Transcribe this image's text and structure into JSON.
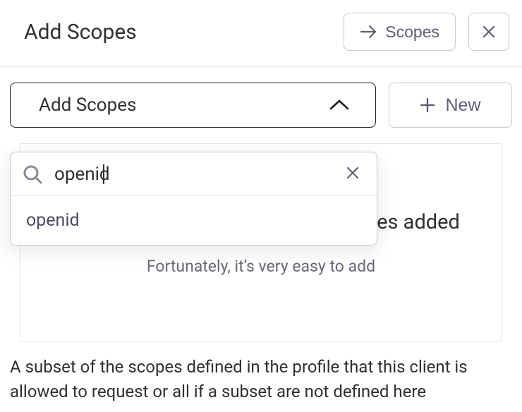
{
  "header": {
    "title": "Add Scopes",
    "scopes_button": "Scopes"
  },
  "toolbar": {
    "dropdown_label": "Add Scopes",
    "new_button": "New"
  },
  "dropdown": {
    "search_value": "openid",
    "options": [
      {
        "label": "openid"
      }
    ]
  },
  "empty_state": {
    "title": "Looks like you don’t have any Scopes added",
    "subtitle": "Fortunately, it’s very easy to add"
  },
  "help_text": "A subset of the scopes defined in the profile that this client is allowed to request or all if a subset are not defined here"
}
